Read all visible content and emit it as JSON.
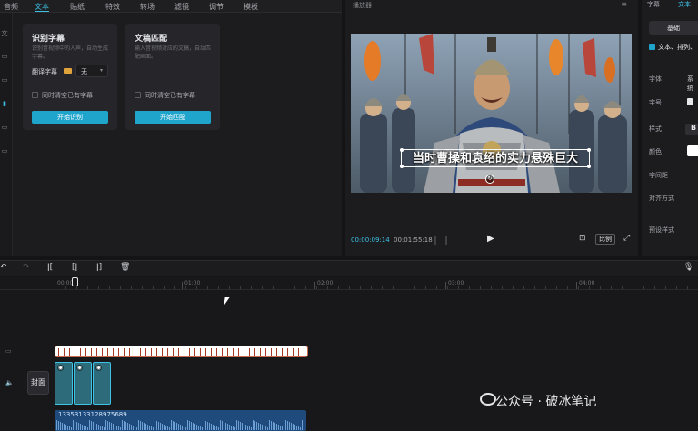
{
  "top_tabs": [
    "音频",
    "文本",
    "贴纸",
    "特效",
    "转场",
    "滤镜",
    "调节",
    "模板"
  ],
  "rail": [
    "文",
    "",
    "",
    "",
    "",
    ""
  ],
  "card_recognize": {
    "title": "识别字幕",
    "description": "识别音视频中的人声，自动生成字幕。",
    "translate_label": "翻译字幕",
    "translate_value": "无",
    "checkbox_label": "同时清空已有字幕",
    "button_label": "开始识别"
  },
  "card_match": {
    "title": "文稿匹配",
    "description": "输入音视频对应的文稿，自动匹配画面。",
    "checkbox_label": "同时清空已有字幕",
    "button_label": "开始匹配"
  },
  "player": {
    "title": "播放器",
    "caption": "当时曹操和袁绍的实力悬殊巨大",
    "time_current": "00:00:09:14",
    "time_total": "00:01:55:18",
    "ratio_label": "比例"
  },
  "inspector": {
    "tabs": [
      "字幕",
      "文本"
    ],
    "segment_label": "基础",
    "checkbox_label": "文本、排列、",
    "font_label": "字体",
    "font_value": "系统",
    "size_label": "字号",
    "style_label": "样式",
    "style_value": "B",
    "color_label": "颜色",
    "spacing_label": "字间距",
    "align_label": "对齐方式",
    "preset_label": "预设样式"
  },
  "timeline": {
    "ruler_labels": [
      "00:00",
      "01:00",
      "02:00",
      "03:00",
      "04:00"
    ],
    "cover_label": "封面",
    "audio_label": "13353133128975689"
  },
  "watermark": "公众号 · 破冰笔记",
  "colors": {
    "accent": "#3dc3e6",
    "button": "#1fa5cc",
    "audio_track": "#1e4a7c",
    "caption_track_mark": "#a33c26"
  }
}
